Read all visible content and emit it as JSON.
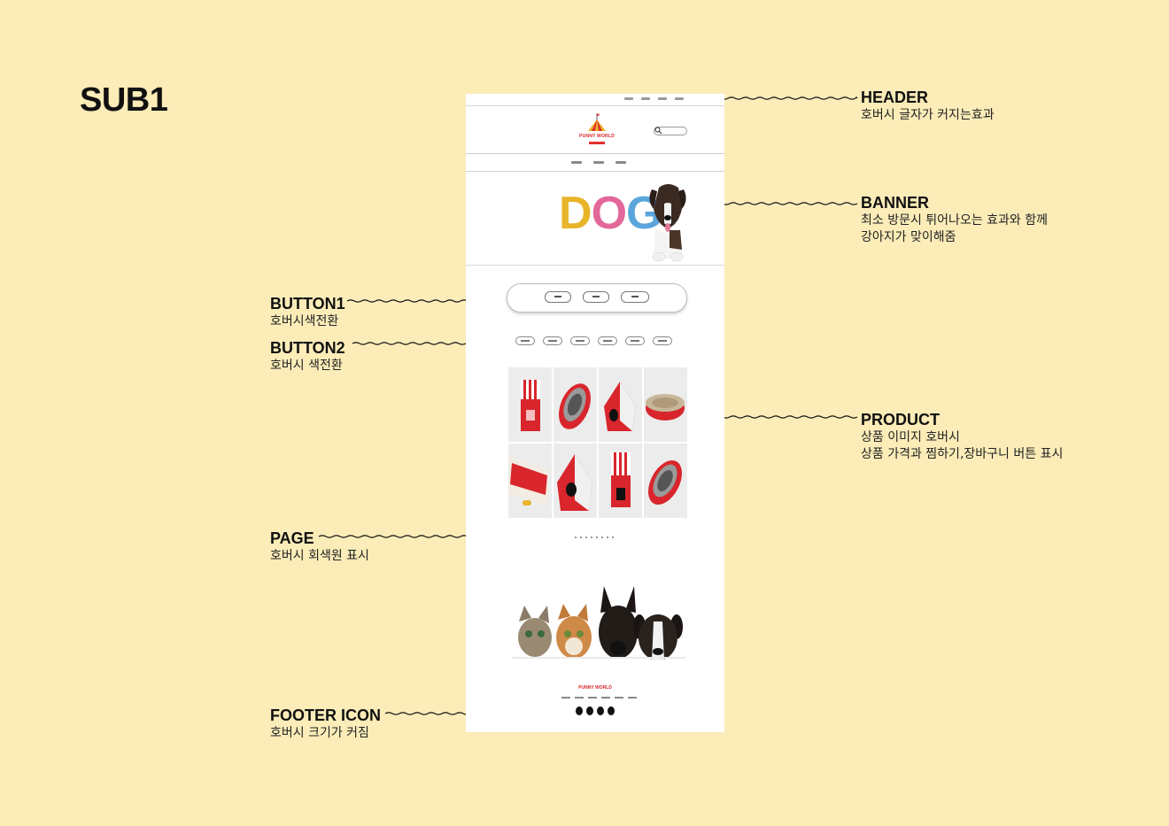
{
  "page": {
    "title": "SUB1"
  },
  "mockup": {
    "logo_text": "PUNNY WORLD",
    "banner_word": [
      "D",
      "O",
      "G"
    ],
    "footer_logo_text": "PUNNY WORLD"
  },
  "annotations": {
    "header": {
      "title": "HEADER",
      "desc": [
        "호버시 글자가 커지는효과"
      ]
    },
    "banner": {
      "title": "BANNER",
      "desc": [
        "최소 방문시 튀어나오는 효과와 함께",
        "강아지가 맞이해줌"
      ]
    },
    "button1": {
      "title": "BUTTON1",
      "desc": [
        "호버시색전환"
      ]
    },
    "button2": {
      "title": "BUTTON2",
      "desc": [
        "호버시 색전환"
      ]
    },
    "product": {
      "title": "PRODUCT",
      "desc": [
        "상품 이미지 호버시",
        "상품 가격과 찜하기,장바구니 버튼 표시"
      ]
    },
    "page": {
      "title": "PAGE",
      "desc": [
        "호버시 회색원 표시"
      ]
    },
    "footer_icon": {
      "title": "FOOTER ICON",
      "desc": [
        "호버시 크기가 커짐"
      ]
    }
  },
  "colors": {
    "background": "#fbecb8",
    "dog_d": "#e8b42a",
    "dog_o": "#e2689a",
    "dog_g": "#5aa6dc",
    "product_red": "#d8262c"
  }
}
